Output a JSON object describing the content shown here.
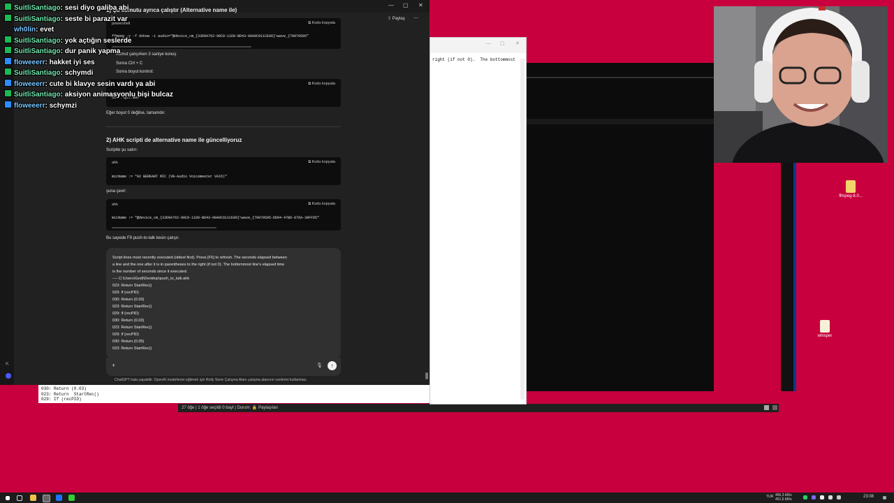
{
  "chat_overlay": [
    {
      "user": "SuitliSantiago",
      "message": "sesi diyo galiba abi",
      "badge": "green"
    },
    {
      "user": "SuitliSantiago",
      "message": "seste bi parazit var",
      "badge": "green"
    },
    {
      "user": "wh0lin",
      "message": "evet",
      "badge": "none"
    },
    {
      "user": "SuitliSantiago",
      "message": "yok açtığın seslerde",
      "badge": "green"
    },
    {
      "user": "SuitliSantiago",
      "message": "dur panik yapma",
      "badge": "green"
    },
    {
      "user": "floweeerr",
      "message": "hakket iyi ses",
      "badge": "blue"
    },
    {
      "user": "SuitliSantiago",
      "message": "schymdi",
      "badge": "green"
    },
    {
      "user": "floweeerr",
      "message": "cute bi klavye sesin vardı ya abi",
      "badge": "blue"
    },
    {
      "user": "SuitliSantiago",
      "message": "aksiyon animasyonlu bişi bulcaz",
      "badge": "green"
    },
    {
      "user": "floweeerr",
      "message": "schymzi",
      "badge": "blue"
    }
  ],
  "chatgpt": {
    "share_label": "Paylaş",
    "top_heading_fragment": "1) Şu komutu ayrıca çalıştır (Alternative name ile)",
    "code1": {
      "lang": "powershell",
      "copy": "Kodu kopyala",
      "line": "ffmpeg -y -f dshow -i audio=\"@device_cm_{33D9A762-90C8-11D0-BD43-00A0C911CE86}\\wave_{70070505\""
    },
    "steps": [
      "Komut çalışırken 3 saniye konuş",
      "Sonra Ctrl + C",
      "Sonra boyut kontrol:"
    ],
    "code2": {
      "copy": "Kodu kopyala",
      "line": "dir .\\gtt.wav"
    },
    "after_code2": "Eğer boyut 0 değilse, tamamdır.",
    "section2_title": "2) AHK scripti de alternative name ile güncelliyoruz",
    "script_label": "Scriptte şu satırı:",
    "code3": {
      "lang": "ahk",
      "copy": "Kodu kopyala",
      "line": "micName := \"02 BERKANT MİC (VB-Audio Voicemeeter VAIO)\""
    },
    "change_label": "şuna çevir:",
    "code4": {
      "lang": "ahk",
      "copy": "Kodu kopyala",
      "line": "micName := \"@device_cm_{33D9A762-90C8-11D0-BD43-00A0C911CE86}\\wave_{70070505-DD94-47BD-876A-30FFD5\""
    },
    "result_line": "Bu sayede F9 push-to-talk kesin çalışır.",
    "pasted_text": [
      "Script lines most recently executed (oldest first).  Press [F5] to refresh.  The seconds elapsed between",
      "a line and the one after it is in parentheses to the right (if not 0).  The bottommost line's elapsed time",
      "is the number of seconds since it executed.",
      "---- C:\\Users\\Godi\\Desktop\\push_to_talk.ahk",
      "023: Return  StartRec()",
      "029: If (recPID)",
      "030: Return (0.03)",
      "023: Return  StartRec()",
      "029: If (recPID)",
      "030: Return (0.03)",
      "023: Return  StartRec()",
      "029: If (recPID)",
      "030: Return (0.05)",
      "023: Return  StartRec()",
      "029: If (recPID)"
    ],
    "plus_label": "+",
    "disclaimer": "ChatGPT hata yapabilir. OpenAI modellerini eğitmek için Rolly Store Çalışma Alanı çalışma alanının verilerini kullanmaz."
  },
  "notepad": {
    "text": "right (if not 0).  The bottommost"
  },
  "log_window": {
    "lines": [
      "030: Return (0.03)",
      "023: Return  StartRec()",
      "029: If (recPID)"
    ]
  },
  "explorer_status": "27 öğe  |  1 öğe seçildi  0 bayt  |  Durum: 🔒 Paylaşılan",
  "desktop_icons": [
    {
      "label": "ffmpeg-8.0..."
    },
    {
      "label": "whisper"
    }
  ],
  "tray": {
    "net_up": "466,3 kB/s",
    "net_down": "451,6 kB/s",
    "lang": "TUR",
    "time": "23:08"
  },
  "colors": {
    "desktop": "#c8003d",
    "chat_green": "#1db954",
    "chat_blue": "#2b8cff"
  }
}
